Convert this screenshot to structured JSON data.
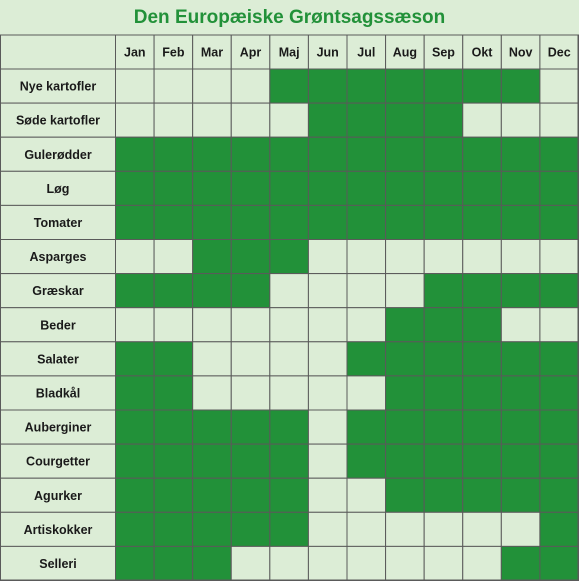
{
  "chart_data": {
    "type": "table",
    "title": "Den Europæiske Grøntsagssæson",
    "columns": [
      "Jan",
      "Feb",
      "Mar",
      "Apr",
      "Maj",
      "Jun",
      "Jul",
      "Aug",
      "Sep",
      "Okt",
      "Nov",
      "Dec"
    ],
    "rows": [
      {
        "label": "Nye kartofler",
        "values": [
          0,
          0,
          0,
          0,
          1,
          1,
          1,
          1,
          1,
          1,
          1,
          0
        ]
      },
      {
        "label": "Søde kartofler",
        "values": [
          0,
          0,
          0,
          0,
          0,
          1,
          1,
          1,
          1,
          0,
          0,
          0
        ]
      },
      {
        "label": "Gulerødder",
        "values": [
          1,
          1,
          1,
          1,
          1,
          1,
          1,
          1,
          1,
          1,
          1,
          1
        ]
      },
      {
        "label": "Løg",
        "values": [
          1,
          1,
          1,
          1,
          1,
          1,
          1,
          1,
          1,
          1,
          1,
          1
        ]
      },
      {
        "label": "Tomater",
        "values": [
          1,
          1,
          1,
          1,
          1,
          1,
          1,
          1,
          1,
          1,
          1,
          1
        ]
      },
      {
        "label": "Asparges",
        "values": [
          0,
          0,
          1,
          1,
          1,
          0,
          0,
          0,
          0,
          0,
          0,
          0
        ]
      },
      {
        "label": "Græskar",
        "values": [
          1,
          1,
          1,
          1,
          0,
          0,
          0,
          0,
          1,
          1,
          1,
          1
        ]
      },
      {
        "label": "Beder",
        "values": [
          0,
          0,
          0,
          0,
          0,
          0,
          0,
          1,
          1,
          1,
          0,
          0
        ]
      },
      {
        "label": "Salater",
        "values": [
          1,
          1,
          0,
          0,
          0,
          0,
          1,
          1,
          1,
          1,
          1,
          1
        ]
      },
      {
        "label": "Bladkål",
        "values": [
          1,
          1,
          0,
          0,
          0,
          0,
          0,
          1,
          1,
          1,
          1,
          1
        ]
      },
      {
        "label": "Auberginer",
        "values": [
          1,
          1,
          1,
          1,
          1,
          0,
          1,
          1,
          1,
          1,
          1,
          1
        ]
      },
      {
        "label": "Courgetter",
        "values": [
          1,
          1,
          1,
          1,
          1,
          0,
          1,
          1,
          1,
          1,
          1,
          1
        ]
      },
      {
        "label": "Agurker",
        "values": [
          1,
          1,
          1,
          1,
          1,
          0,
          0,
          1,
          1,
          1,
          1,
          1
        ]
      },
      {
        "label": "Artiskokker",
        "values": [
          1,
          1,
          1,
          1,
          1,
          0,
          0,
          0,
          0,
          0,
          0,
          1
        ]
      },
      {
        "label": "Selleri",
        "values": [
          1,
          1,
          1,
          0,
          0,
          0,
          0,
          0,
          0,
          0,
          1,
          1
        ]
      }
    ],
    "colors": {
      "in_season": "#229139",
      "off_season": "#dcedd6",
      "grid": "#5a5a5a",
      "title": "#229139"
    }
  }
}
